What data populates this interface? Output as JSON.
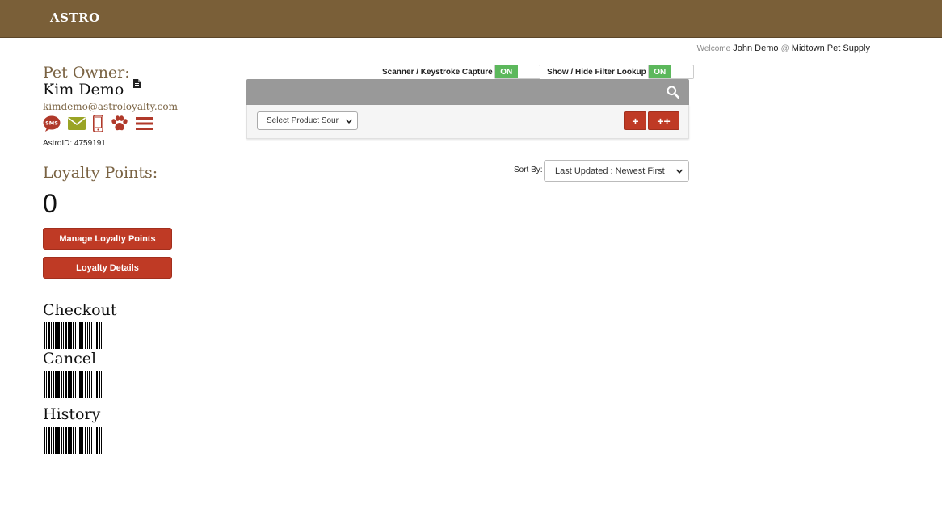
{
  "header": {
    "logo": "ASTRO",
    "color": "#7a5f38"
  },
  "welcome": {
    "prefix": "Welcome",
    "user": "John Demo",
    "at": "@",
    "store": "Midtown Pet Supply"
  },
  "owner": {
    "label": "Pet Owner:",
    "name": "Kim Demo",
    "email": "kimdemo@astroloyalty.com",
    "astro_id": "AstroID: 4759191",
    "icons": [
      "sms-icon",
      "envelope-icon",
      "mobile-phone-icon",
      "paw-icon",
      "menu-icon"
    ]
  },
  "loyalty": {
    "label": "Loyalty Points:",
    "value": "0",
    "manage_label": "Manage Loyalty Points",
    "details_label": "Loyalty Details"
  },
  "barcodes": {
    "checkout": "Checkout",
    "cancel": "Cancel",
    "history": "History"
  },
  "toggles": {
    "scanner": {
      "label": "Scanner / Keystroke Capture",
      "state": "ON"
    },
    "filter": {
      "label": "Show / Hide Filter Lookup",
      "state": "ON"
    }
  },
  "filter": {
    "product_source": "Select Product Sour",
    "add_one": "+",
    "add_many": "++"
  },
  "sort": {
    "label": "Sort By:",
    "value": "Last Updated : Newest First"
  },
  "colors": {
    "accent_red": "#bf3a25",
    "toggle_green": "#5cb85c",
    "icon_olive": "#9aa425",
    "icon_red": "#b0392a",
    "label_brown": "#7a6343"
  }
}
